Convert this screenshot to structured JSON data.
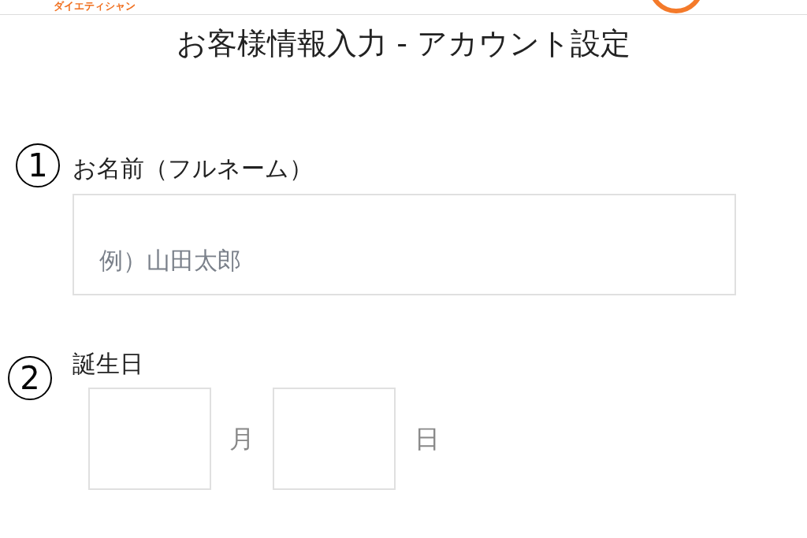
{
  "header": {
    "logo": "ダイエティシャン"
  },
  "title": "お客様情報入力 - アカウント設定",
  "fields": [
    {
      "marker": "1",
      "label": "お名前（フルネーム）",
      "placeholder": "例）山田太郎"
    },
    {
      "marker": "2",
      "label": "誕生日",
      "month_unit": "月",
      "day_unit": "日"
    }
  ]
}
